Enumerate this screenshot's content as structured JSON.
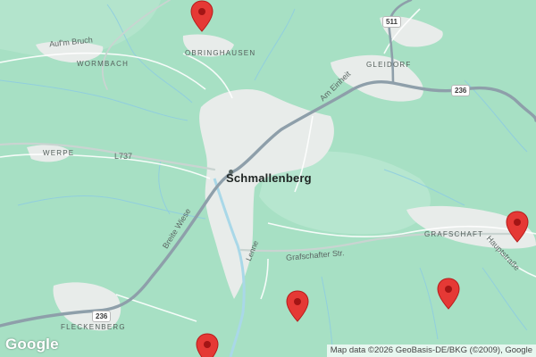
{
  "map": {
    "towns": {
      "wormbach": "WORMBACH",
      "obringhausen": "OBRINGHAUSEN",
      "gleidorf": "GLEIDORF",
      "werpe": "WERPE",
      "grafschaft": "GRAFSCHAFT",
      "fleckenberg": "FLECKENBERG"
    },
    "city": "Schmallenberg",
    "streets": {
      "aufm_bruch": "Auf'm Bruch",
      "l737": "L737",
      "am_einheit": "Am Einheit",
      "breite_wiese": "Breite Wiese",
      "lenne": "Lenne",
      "grafschafter_str": "Grafschafter Str.",
      "hauptstrasse": "Hauptstraße"
    },
    "shields": {
      "r511": "511",
      "r236_east": "236",
      "r236_west": "236"
    },
    "markers": [
      {
        "label": "map-marker-obringhausen"
      },
      {
        "label": "map-marker-hauptstrasse"
      },
      {
        "label": "map-marker-grafschaft-south"
      },
      {
        "label": "map-marker-lenne-south"
      },
      {
        "label": "map-marker-fleckenberg-south"
      }
    ],
    "colors": {
      "forest": "#a7e0c4",
      "urban": "#e8ecea",
      "road": "#8e9faa",
      "minor_road": "#c9d4d1",
      "water": "#a9d8e8",
      "marker": "#e53935"
    }
  },
  "branding": {
    "logo": "Google"
  },
  "attribution": "Map data ©2026 GeoBasis-DE/BKG (©2009), Google"
}
